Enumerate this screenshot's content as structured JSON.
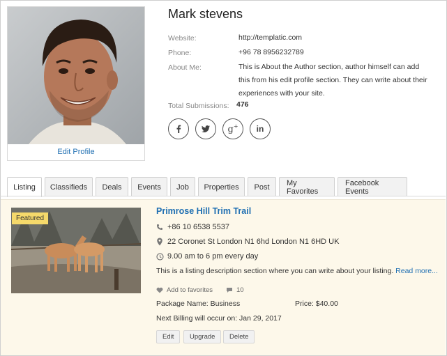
{
  "profile": {
    "name": "Mark stevens",
    "edit_profile_label": "Edit Profile",
    "website_label": "Website:",
    "website_value": "http://templatic.com",
    "phone_label": "Phone:",
    "phone_value": "+96 78 8956232789",
    "about_label": "About Me:",
    "about_value": "This is About the Author section, author himself can add this from his edit profile section. They can write about their experiences with your site.",
    "submissions_label": "Total Submissions:",
    "submissions_value": "476",
    "social_icons": [
      "facebook-icon",
      "twitter-icon",
      "google-plus-icon",
      "linkedin-icon"
    ]
  },
  "tabs": [
    {
      "label": "Listing",
      "active": true
    },
    {
      "label": "Classifieds"
    },
    {
      "label": "Deals"
    },
    {
      "label": "Events"
    },
    {
      "label": "Job"
    },
    {
      "label": "Properties"
    },
    {
      "label": "Post"
    },
    {
      "label": "My Favorites"
    },
    {
      "label": "Facebook Events"
    }
  ],
  "listing": {
    "badge": "Featured",
    "title": "Primrose Hill Trim Trail",
    "phone": "+86 10 6538 5537",
    "address": "22 Coronet St London N1 6hd London N1 6HD UK",
    "hours": "9.00 am to 6 pm every day",
    "description": "This is a listing description section where you can write about your listing.",
    "read_more": "Read more...",
    "favorites_label": "Add to favorites",
    "comments_count": "10",
    "package_label": "Package Name: Business",
    "price_label": "Price: $40.00",
    "billing_label": "Next Billing will occur on: Jan 29, 2017",
    "actions": {
      "edit": "Edit",
      "upgrade": "Upgrade",
      "delete": "Delete"
    }
  },
  "colors": {
    "link": "#1f6fb2",
    "card_bg": "#fdf8ea",
    "badge_bg": "#f5d96b"
  }
}
